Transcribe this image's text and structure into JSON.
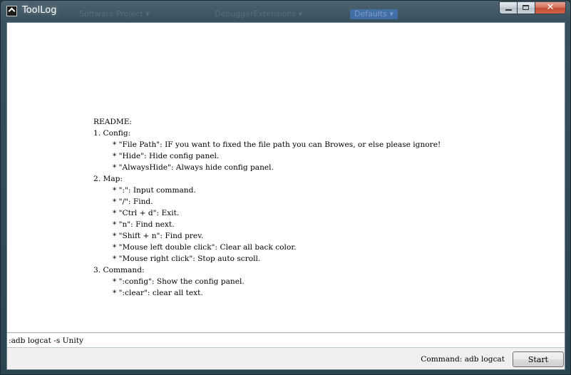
{
  "window": {
    "title": "ToolLog",
    "background_hints": [
      "Software Project ▾",
      "DebuggerExtensions ▾",
      "Defaults ▾"
    ],
    "close_glyph": "✕"
  },
  "log": {
    "lines": [
      "README:",
      "1. Config:",
      "        * \"File Path\": IF you want to fixed the file path you can Browes, or else please ignore!",
      "        * \"Hide\": Hide config panel.",
      "        * \"AlwaysHide\": Always hide config panel.",
      "2. Map:",
      "        * \":\": Input command.",
      "        * \"/\": Find.",
      "        * \"Ctrl + d\": Exit.",
      "        * \"n\": Find next.",
      "        * \"Shift + n\": Find prev.",
      "        * \"Mouse left double click\": Clear all back color.",
      "        * \"Mouse right click\": Stop auto scroll.",
      "3. Command:",
      "        * \":config\": Show the config panel.",
      "        * \":clear\": clear all text."
    ]
  },
  "command": {
    "value": ":adb logcat -s Unity"
  },
  "status": {
    "text": "Command: adb logcat"
  },
  "start_button": {
    "label": "Start"
  },
  "colors": {
    "window_frame": "#37505c",
    "close_button": "#c24a30",
    "client_background": "#f0f0f0",
    "log_background": "#ffffff"
  }
}
